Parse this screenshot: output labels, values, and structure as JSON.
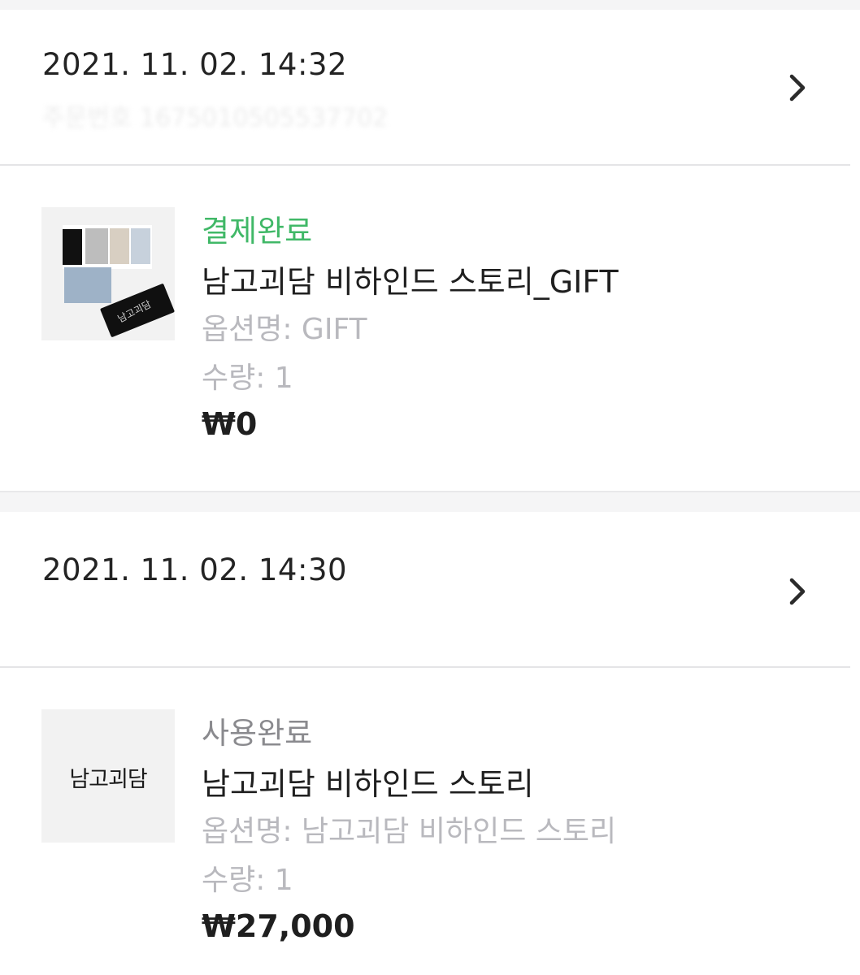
{
  "orders": [
    {
      "date": "2021. 11. 02. 14:32",
      "order_number": "주문번호 1675010505537702",
      "item": {
        "status": "결제완료",
        "status_color": "#40b867",
        "title": "남고괴담 비하인드 스토리_GIFT",
        "option": "옵션명: GIFT",
        "quantity": "수량: 1",
        "price": "₩0",
        "thumbnail_logo": "남고괴담"
      }
    },
    {
      "date": "2021. 11. 02. 14:30",
      "order_number": "",
      "item": {
        "status": "사용완료",
        "status_color": "#8a8a8e",
        "title": "남고괴담 비하인드 스토리",
        "option": "옵션명: 남고괴담 비하인드 스토리",
        "quantity": "수량: 1",
        "price": "₩27,000",
        "thumbnail_logo": "남고괴담"
      }
    }
  ],
  "icons": {
    "chevron": "chevron-right-icon"
  }
}
